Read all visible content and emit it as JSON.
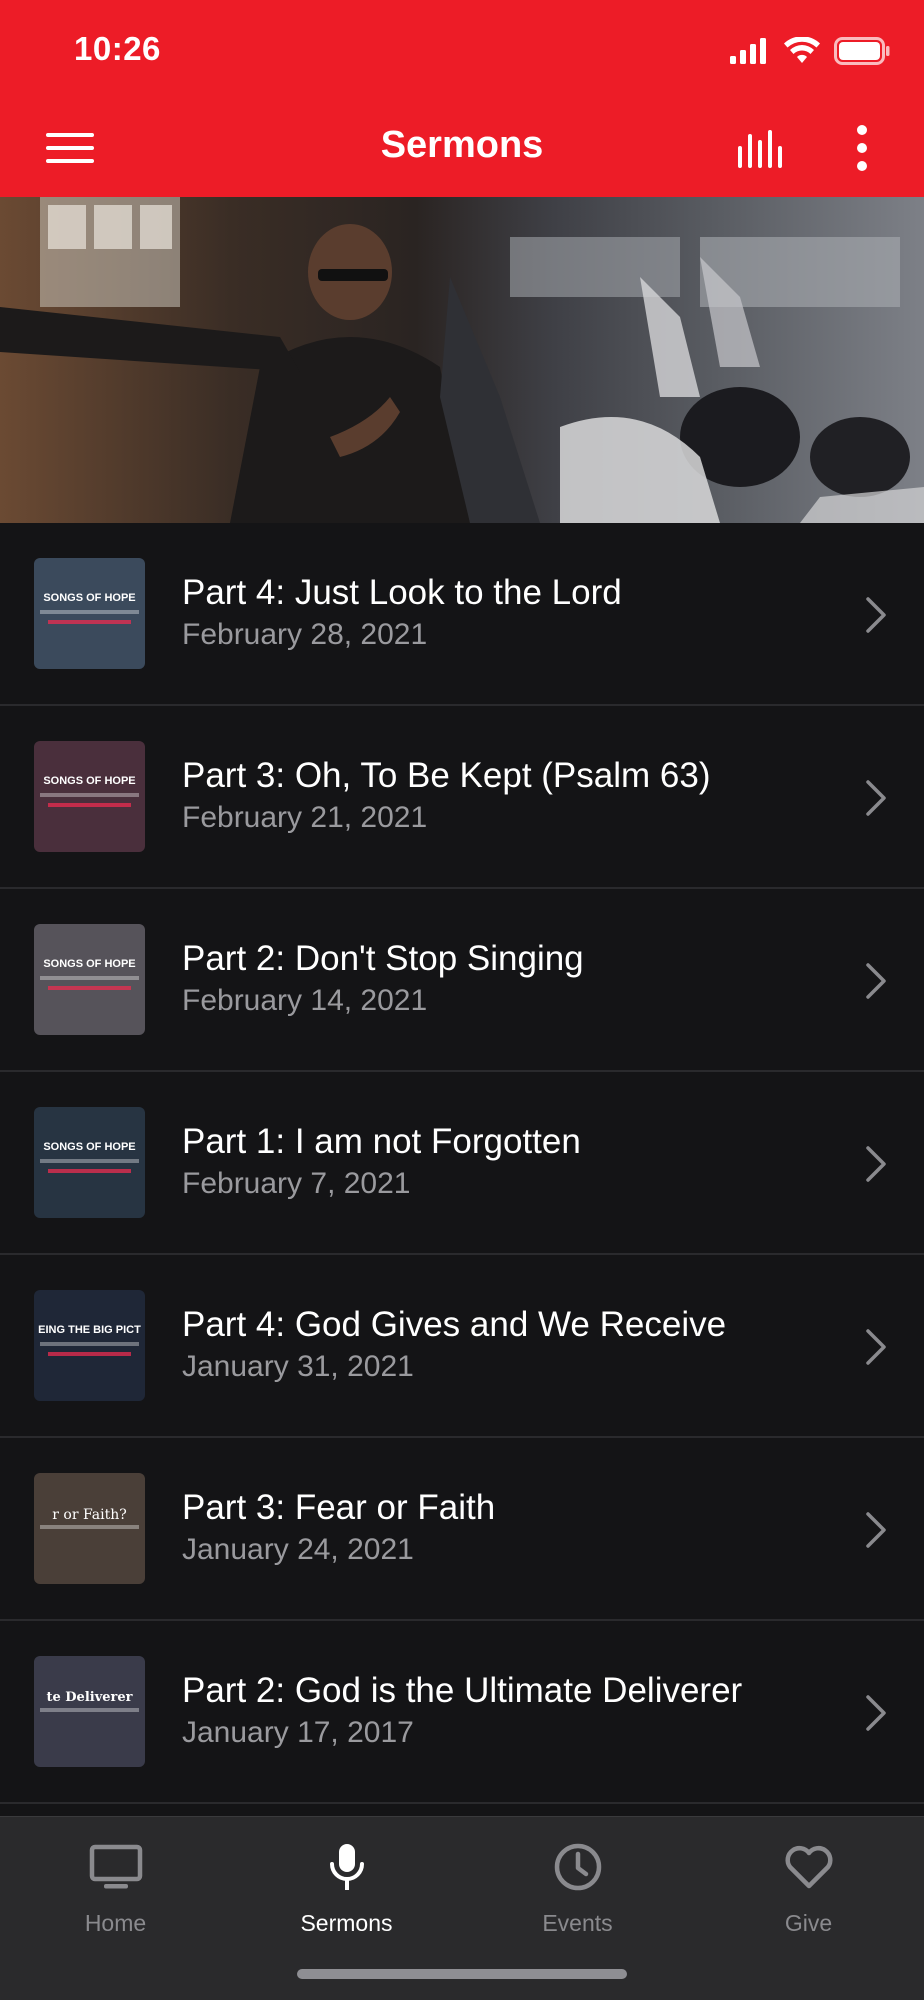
{
  "status_bar": {
    "time": "10:26"
  },
  "header": {
    "title": "Sermons",
    "menu_icon": "hamburger-menu-icon",
    "audio_icon": "audio-bars-icon",
    "more_icon": "vertical-ellipsis-icon",
    "background_color": "#ed1c27"
  },
  "sermons": [
    {
      "title": "Part 4:  Just Look to the Lord",
      "date": "February 28, 2021",
      "thumb_text": "SONGS OF HOPE",
      "thumb_color": "#3b4a5c"
    },
    {
      "title": "Part 3: Oh, To Be Kept (Psalm 63)",
      "date": "February 21, 2021",
      "thumb_text": "SONGS OF HOPE",
      "thumb_color": "#4a2f3c"
    },
    {
      "title": "Part 2: Don't Stop Singing",
      "date": "February 14, 2021",
      "thumb_text": "SONGS OF HOPE",
      "thumb_color": "#56535a"
    },
    {
      "title": "Part 1:  I am not Forgotten",
      "date": "February 7, 2021",
      "thumb_text": "SONGS OF HOPE",
      "thumb_color": "#273442"
    },
    {
      "title": "Part 4:  God Gives and We Receive",
      "date": "January 31, 2021",
      "thumb_text": "EING THE BIG PICT",
      "thumb_color": "#1f2737"
    },
    {
      "title": "Part 3:  Fear or Faith",
      "date": "January 24, 2021",
      "thumb_text": "r or Faith?",
      "thumb_color": "#4a3f38"
    },
    {
      "title": "Part 2:  God is the Ultimate Deliverer",
      "date": "January 17, 2017",
      "thumb_text": "te Deliverer",
      "thumb_color": "#3a3b4a"
    }
  ],
  "tabs": [
    {
      "label": "Home",
      "icon": "tv-icon",
      "active": false
    },
    {
      "label": "Sermons",
      "icon": "microphone-icon",
      "active": true
    },
    {
      "label": "Events",
      "icon": "clock-icon",
      "active": false
    },
    {
      "label": "Give",
      "icon": "heart-icon",
      "active": false
    }
  ]
}
